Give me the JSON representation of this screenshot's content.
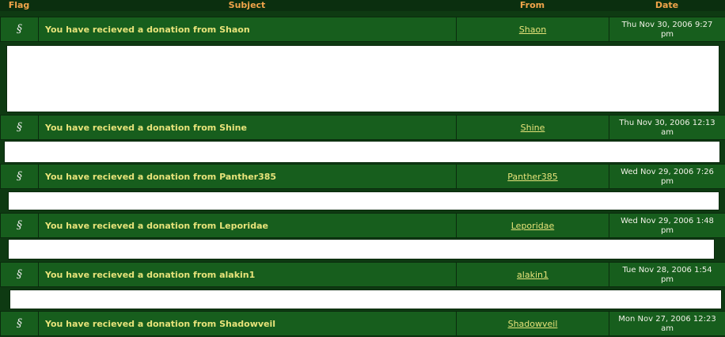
{
  "header": {
    "flag": "Flag",
    "subject": "Subject",
    "from": "From",
    "date": "Date"
  },
  "messages": [
    {
      "subject": "You have recieved a donation from Shaon",
      "from": "Shaon",
      "date_line1": "Thu Nov 30, 2006 9:27",
      "date_line2": "pm",
      "flag_icon": "scroll-icon"
    },
    {
      "subject": "You have recieved a donation from Shine",
      "from": "Shine",
      "date_line1": "Thu Nov 30, 2006 12:13",
      "date_line2": "am",
      "flag_icon": "scroll-icon"
    },
    {
      "subject": "You have recieved a donation from Panther385",
      "from": "Panther385",
      "date_line1": "Wed Nov 29, 2006 7:26",
      "date_line2": "pm",
      "flag_icon": "scroll-icon"
    },
    {
      "subject": "You have recieved a donation from Leporidae",
      "from": "Leporidae",
      "date_line1": "Wed Nov 29, 2006 1:48",
      "date_line2": "pm",
      "flag_icon": "scroll-icon"
    },
    {
      "subject": "You have recieved a donation from alakin1",
      "from": "alakin1",
      "date_line1": "Tue Nov 28, 2006 1:54",
      "date_line2": "pm",
      "flag_icon": "scroll-icon"
    },
    {
      "subject": "You have recieved a donation from Shadowveil",
      "from": "Shadowveil",
      "date_line1": "Mon Nov 27, 2006 12:23",
      "date_line2": "am",
      "flag_icon": "scroll-icon"
    }
  ],
  "colors": {
    "background": "#0e3a12",
    "row": "#175e1d",
    "header_text": "#f1a44a",
    "subject_text": "#e7e37a",
    "body_panel": "#ffffff"
  }
}
